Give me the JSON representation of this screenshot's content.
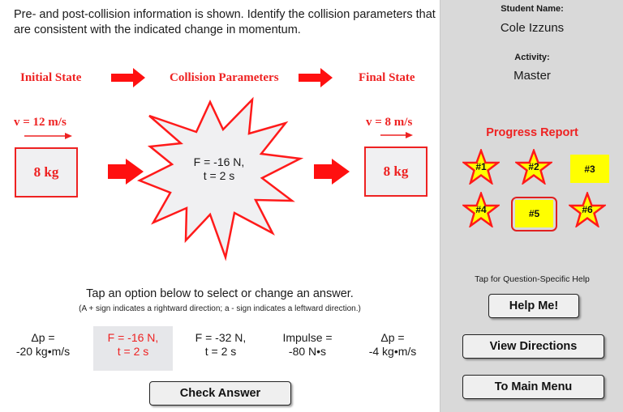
{
  "instructions": "Pre- and post-collision information is shown. Identify the collision parameters that are consistent with the indicated change in momentum.",
  "diagram": {
    "stages": [
      "Initial State",
      "Collision Parameters",
      "Final State"
    ],
    "initial": {
      "velocity": "v = 12 m/s",
      "mass": "8 kg"
    },
    "collision": {
      "line1": "F = -16 N,",
      "line2": "t = 2 s"
    },
    "final": {
      "velocity": "v = 8 m/s",
      "mass": "8 kg"
    }
  },
  "prompt": {
    "main": "Tap an option below to select or change an answer.",
    "note": "(A + sign indicates a rightward direction; a - sign indicates a leftward direction.)"
  },
  "options": [
    {
      "line1": "Δp =",
      "line2": "-20 kg•m/s",
      "selected": false
    },
    {
      "line1": "F = -16 N,",
      "line2": "t = 2 s",
      "selected": true
    },
    {
      "line1": "F = -32 N,",
      "line2": "t = 2 s",
      "selected": false
    },
    {
      "line1": "Impulse =",
      "line2": "-80 N•s",
      "selected": false
    },
    {
      "line1": "Δp =",
      "line2": "-4 kg•m/s",
      "selected": false
    }
  ],
  "check_answer_label": "Check Answer",
  "sidebar": {
    "student_name_label": "Student Name:",
    "student_name": "Cole Izzuns",
    "activity_label": "Activity:",
    "activity": "Master",
    "progress_title": "Progress Report",
    "progress": [
      {
        "label": "#1",
        "status": "star"
      },
      {
        "label": "#2",
        "status": "star"
      },
      {
        "label": "#3",
        "status": "pending"
      },
      {
        "label": "#4",
        "status": "star"
      },
      {
        "label": "#5",
        "status": "current"
      },
      {
        "label": "#6",
        "status": "star"
      }
    ],
    "help_caption": "Tap for Question-Specific Help",
    "help_button": "Help Me!",
    "directions_button": "View Directions",
    "main_menu_button": "To Main Menu"
  },
  "colors": {
    "accent_red": "#ee2222",
    "star_fill": "#ffff00",
    "sidebar_bg": "#d9d9d9",
    "selected_option_bg": "#e6e7ea"
  }
}
